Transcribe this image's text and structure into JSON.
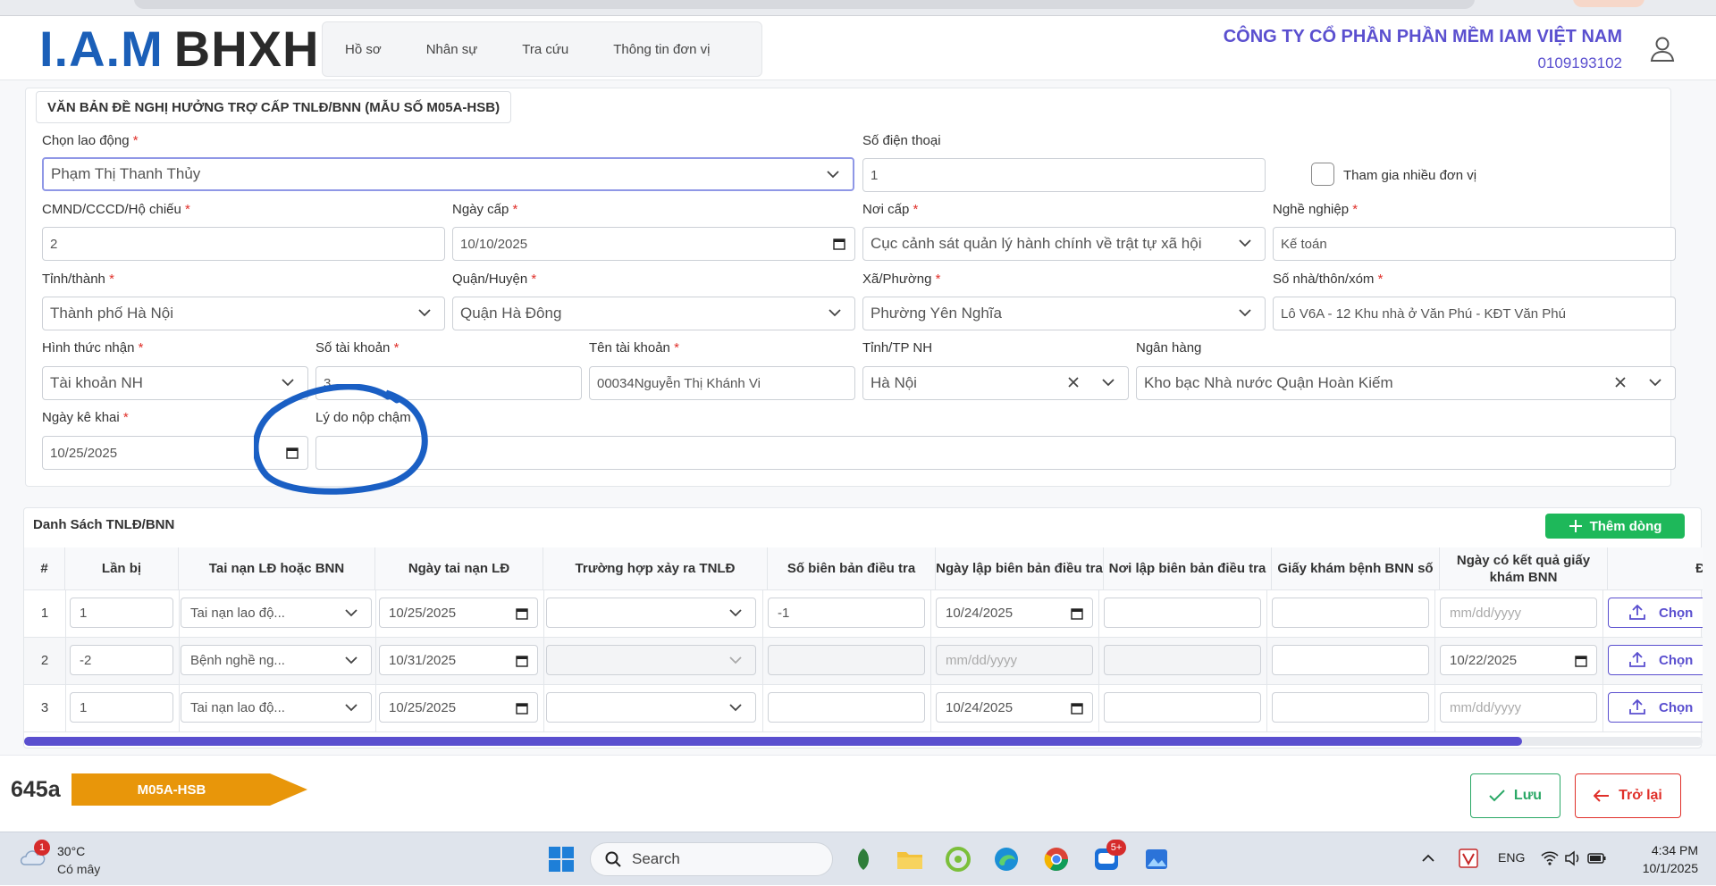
{
  "header": {
    "logo_main": "I.A.M",
    "logo_sub": "BHXH",
    "nav": [
      "Hồ sơ",
      "Nhân sự",
      "Tra cứu",
      "Thông tin đơn vị"
    ],
    "company_name": "CÔNG TY CỔ PHẦN PHẦN MỀM IAM VIỆT NAM",
    "tax_code": "0109193102"
  },
  "form": {
    "title": "VĂN BẢN ĐỀ NGHỊ HƯỞNG TRỢ CẤP TNLĐ/BNN (MẪU SỐ M05A-HSB)",
    "required_mark": "*",
    "employee": {
      "label": "Chọn lao động",
      "value": "Phạm Thị Thanh Thủy"
    },
    "phone": {
      "label": "Số điện thoại",
      "value": "1"
    },
    "multi_unit": {
      "label": "Tham gia nhiều đơn vị",
      "checked": false
    },
    "id_number": {
      "label": "CMND/CCCD/Hộ chiếu",
      "value": "2"
    },
    "issue_date": {
      "label": "Ngày cấp",
      "value": "10/10/2025"
    },
    "issue_place": {
      "label": "Nơi cấp",
      "value": "Cục cảnh sát quản lý hành chính về trật tự xã hội"
    },
    "occupation": {
      "label": "Nghề nghiệp",
      "value": "Kế toán"
    },
    "province": {
      "label": "Tỉnh/thành",
      "value": "Thành phố Hà Nội"
    },
    "district": {
      "label": "Quận/Huyện",
      "value": "Quận Hà Đông"
    },
    "ward": {
      "label": "Xã/Phường",
      "value": "Phường Yên Nghĩa"
    },
    "address": {
      "label": "Số nhà/thôn/xóm",
      "value": "Lô V6A - 12 Khu nhà ở Văn Phú - KĐT Văn Phú"
    },
    "receive_method": {
      "label": "Hình thức nhận",
      "value": "Tài khoản NH"
    },
    "account_no": {
      "label": "Số tài khoản",
      "value": "3"
    },
    "account_name": {
      "label": "Tên tài khoản",
      "value": "00034Nguyễn Thị Khánh Vi"
    },
    "bank_province": {
      "label": "Tỉnh/TP NH",
      "value": "Hà Nội"
    },
    "bank": {
      "label": "Ngân hàng",
      "value": "Kho bạc Nhà nước Quận Hoàn Kiếm"
    },
    "declare_date": {
      "label": "Ngày kê khai",
      "value": "10/25/2025"
    },
    "late_reason": {
      "label": "Lý do nộp chậm",
      "value": ""
    }
  },
  "table": {
    "title": "Danh Sách TNLĐ/BNN",
    "add_button": "Thêm dòng",
    "columns": [
      "#",
      "Lần bị",
      "Tai nạn LĐ hoặc BNN",
      "Ngày tai nạn LĐ",
      "Trường hợp xảy ra TNLĐ",
      "Số biên bản điều tra",
      "Ngày lập biên bản điều tra",
      "Nơi lập biên bản điều tra",
      "Giấy khám bệnh BNN số",
      "Ngày có kết quả giấy khám BNN",
      "Đ"
    ],
    "date_placeholder": "mm/dd/yyyy",
    "upload_label": "Chọn",
    "rows": [
      {
        "no": "1",
        "times": "1",
        "type": "Tai nạn lao độ...",
        "accident_date": "10/25/2025",
        "case": "",
        "report_no": "-1",
        "report_date": "10/24/2025",
        "report_place": "",
        "cert_no": "",
        "cert_date": ""
      },
      {
        "no": "2",
        "times": "-2",
        "type": "Bệnh nghề ng...",
        "accident_date": "10/31/2025",
        "case": "",
        "report_no": "",
        "report_date": "",
        "report_place": "",
        "cert_no": "",
        "cert_date": "10/22/2025"
      },
      {
        "no": "3",
        "times": "1",
        "type": "Tai nạn lao độ...",
        "accident_date": "10/25/2025",
        "case": "",
        "report_no": "",
        "report_date": "10/24/2025",
        "report_place": "",
        "cert_no": "",
        "cert_date": ""
      }
    ]
  },
  "footer": {
    "code": "645a",
    "form_tag": "M05A-HSB",
    "save_label": "Lưu",
    "back_label": "Trở lại"
  },
  "taskbar": {
    "weather_badge": "1",
    "temperature": "30°C",
    "condition": "Có mây",
    "search_placeholder": "Search",
    "zalo_badge": "5+",
    "language": "ENG",
    "time": "4:34 PM",
    "date": "10/1/2025"
  },
  "colors": {
    "brand_blue": "#1b5fb8",
    "brand_red": "#e02020",
    "accent_purple": "#5a4fcf",
    "add_green": "#1eb85a",
    "tag_orange": "#e8960a",
    "save_green": "#2aa866",
    "back_red": "#e0302a",
    "annotation_blue": "#1a5fc4"
  }
}
